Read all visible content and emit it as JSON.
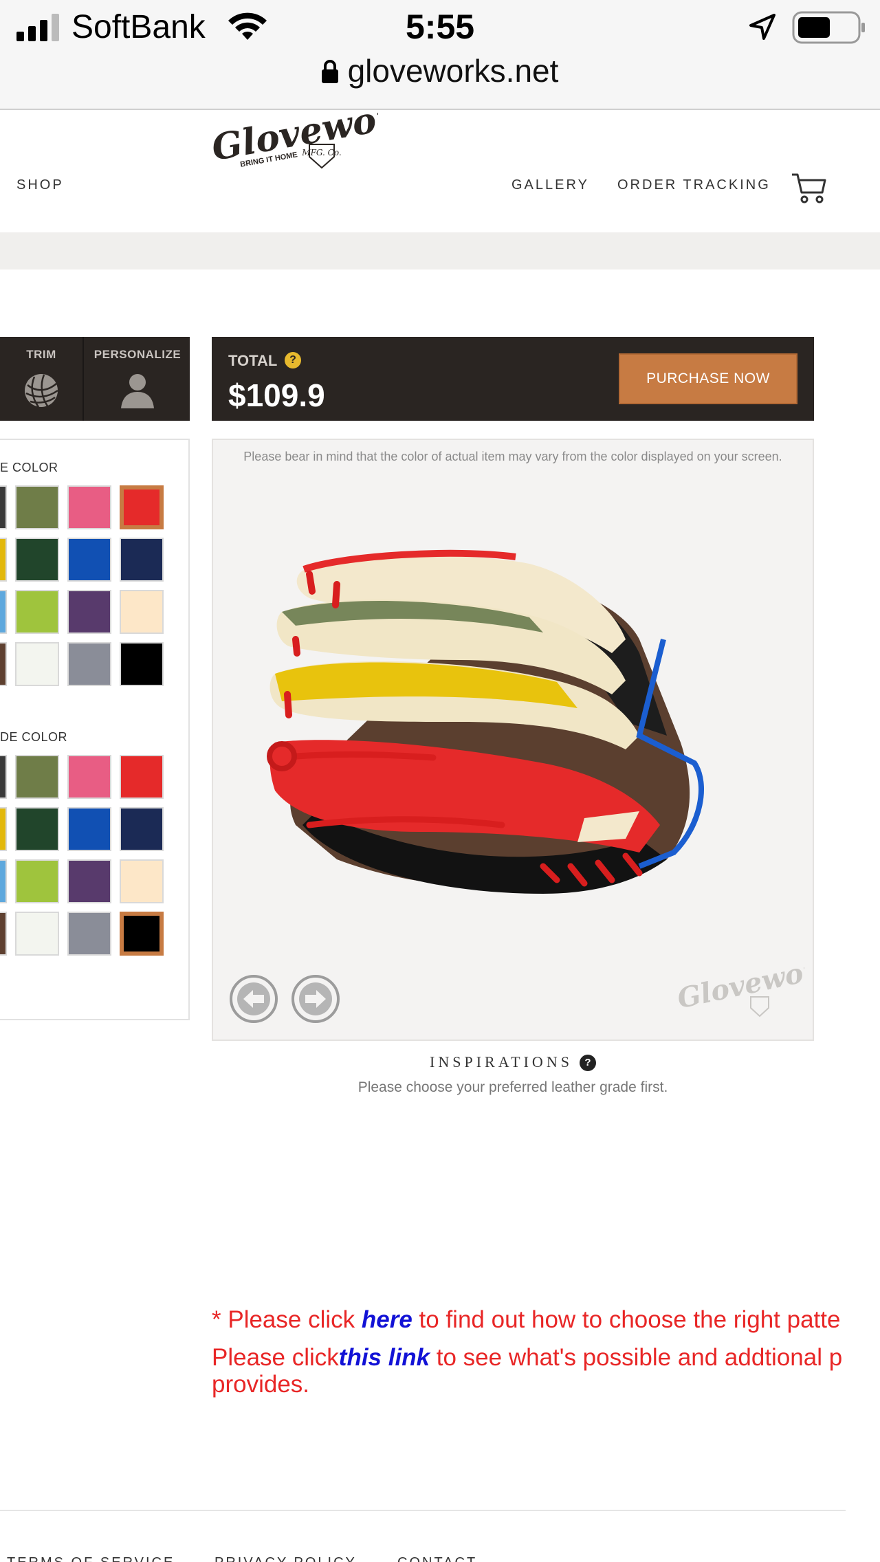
{
  "status_bar": {
    "carrier": "SoftBank",
    "time": "5:55",
    "url": "gloveworks.net"
  },
  "header": {
    "logo_text": "Gloveworks",
    "logo_tagline": "BRING IT HOME",
    "logo_badge": "MFG. Co.",
    "nav": {
      "shop": "SHOP",
      "gallery": "GALLERY",
      "order_tracking": "ORDER TRACKING"
    }
  },
  "customizer": {
    "tabs": [
      {
        "label": "TRIM",
        "icon": "yarn-ball-icon"
      },
      {
        "label": "PERSONALIZE",
        "icon": "person-icon"
      }
    ],
    "sections": [
      {
        "title": "E COLOR",
        "colors": [
          "#3a3a3a",
          "#6f7d48",
          "#e85d84",
          "#e52a2a",
          "#e2b80c",
          "#21452b",
          "#1150b3",
          "#1b2a55",
          "#5ea8dd",
          "#9fc43d",
          "#583a6c",
          "#fde7c8",
          "#5e4030",
          "#f3f5ef",
          "#8a8d98",
          "#000000"
        ],
        "selected_index": 3
      },
      {
        "title": "DE COLOR",
        "colors": [
          "#3a3a3a",
          "#6f7d48",
          "#e85d84",
          "#e52a2a",
          "#e2b80c",
          "#21452b",
          "#1150b3",
          "#1b2a55",
          "#5ea8dd",
          "#9fc43d",
          "#583a6c",
          "#fde7c8",
          "#5e4030",
          "#f3f5ef",
          "#8a8d98",
          "#000000"
        ],
        "selected_index": 15
      }
    ],
    "accent_color": "#c77b43",
    "total": {
      "label": "TOTAL",
      "help": "?",
      "value": "$109.9"
    },
    "purchase_label": "PURCHASE NOW",
    "disclaimer": "Please bear in mind that the color of actual item may vary from the color displayed on your screen.",
    "watermark_text": "Gloveworks",
    "inspirations": {
      "title": "INSPIRATIONS",
      "help": "?",
      "note": "Please choose your preferred leather grade first."
    }
  },
  "notes": {
    "line1_prefix": "* Please click ",
    "line1_link": "here",
    "line1_suffix": " to find out how to choose the right patte",
    "line2_prefix": "Please click",
    "line2_link": "this link",
    "line2_suffix": " to see what's possible and addtional p",
    "line3": "provides."
  },
  "footer": {
    "links": [
      "TERMS OF SERVICE",
      "PRIVACY POLICY",
      "CONTACT"
    ]
  }
}
